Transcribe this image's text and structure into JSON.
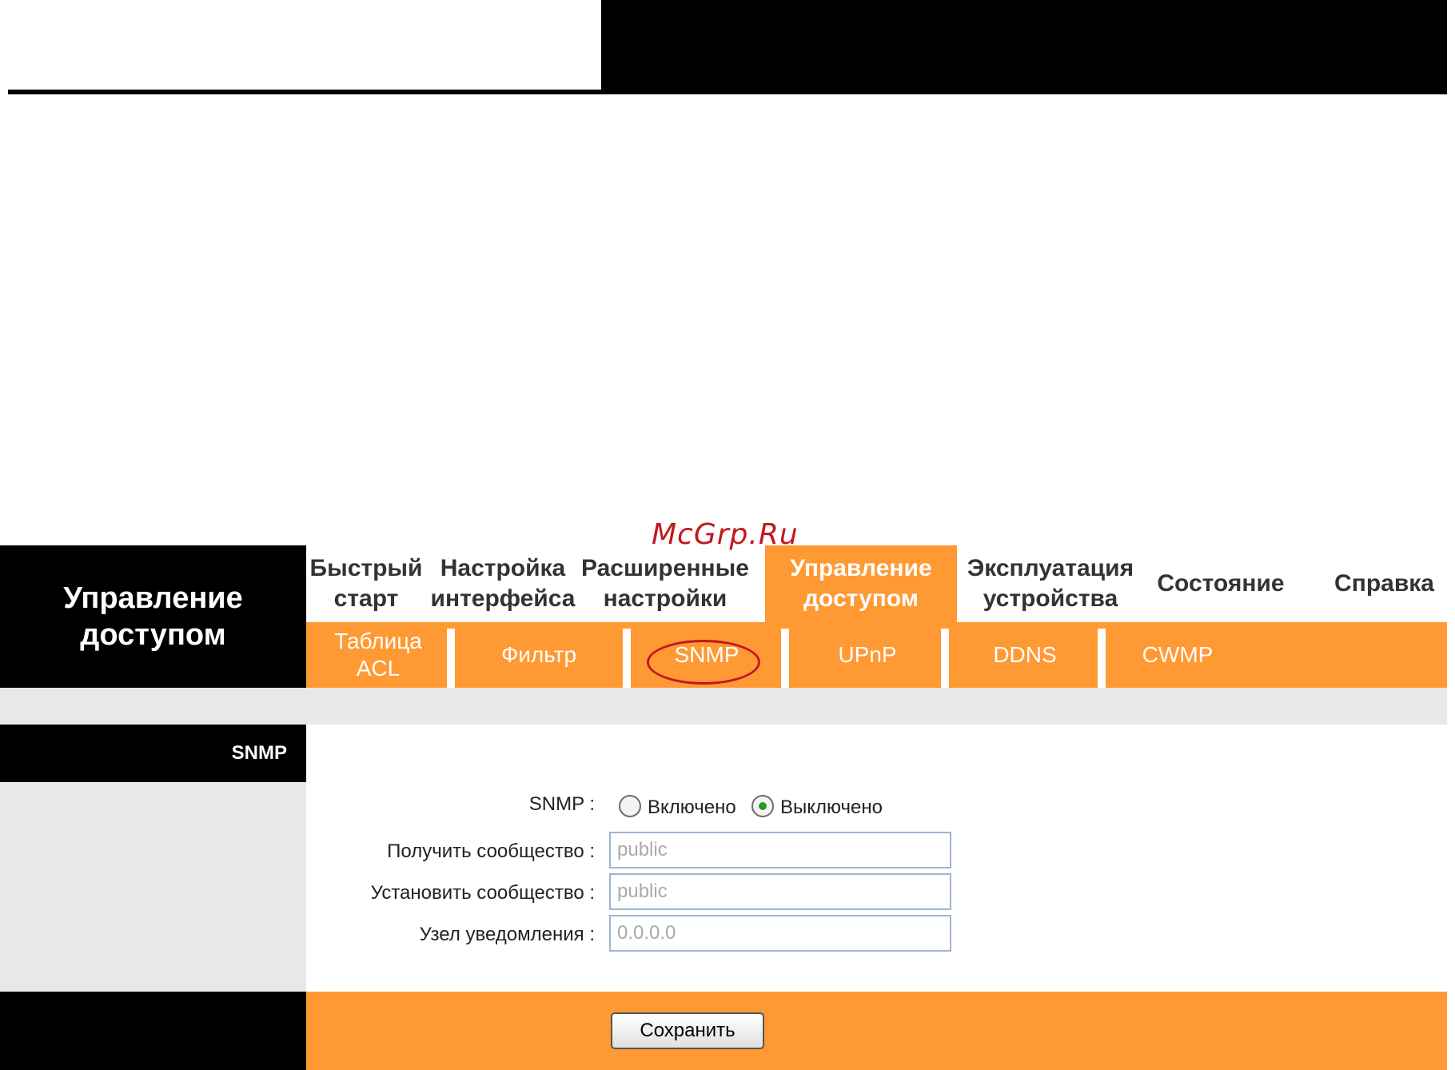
{
  "watermark": "McGrp.Ru",
  "side_title": "Управление доступом",
  "main_nav": [
    {
      "label": "Быстрый\nстарт",
      "active": false
    },
    {
      "label": "Настройка\nинтерфейса",
      "active": false
    },
    {
      "label": "Расширенные\nнастройки",
      "active": false
    },
    {
      "label": "Управление\nдоступом",
      "active": true
    },
    {
      "label": "Эксплуатация\nустройства",
      "active": false
    },
    {
      "label": "Состояние",
      "active": false
    },
    {
      "label": "Справка",
      "active": false
    }
  ],
  "sub_nav": [
    {
      "label": "Таблица\nACL"
    },
    {
      "label": "Фильтр"
    },
    {
      "label": "SNMP"
    },
    {
      "label": "UPnP"
    },
    {
      "label": "DDNS"
    },
    {
      "label": "CWMP"
    }
  ],
  "section_title": "SNMP",
  "form": {
    "snmp_label": "SNMP :",
    "snmp_on_label": "Включено",
    "snmp_off_label": "Выключено",
    "snmp_state": "off",
    "get_community_label": "Получить сообщество :",
    "get_community_value": "public",
    "set_community_label": "Установить сообщество :",
    "set_community_value": "public",
    "trap_host_label": "Узел уведомления :",
    "trap_host_value": "0.0.0.0"
  },
  "save_label": "Сохранить",
  "colors": {
    "accent": "#ff9933",
    "highlight_circle": "#c0191f"
  }
}
